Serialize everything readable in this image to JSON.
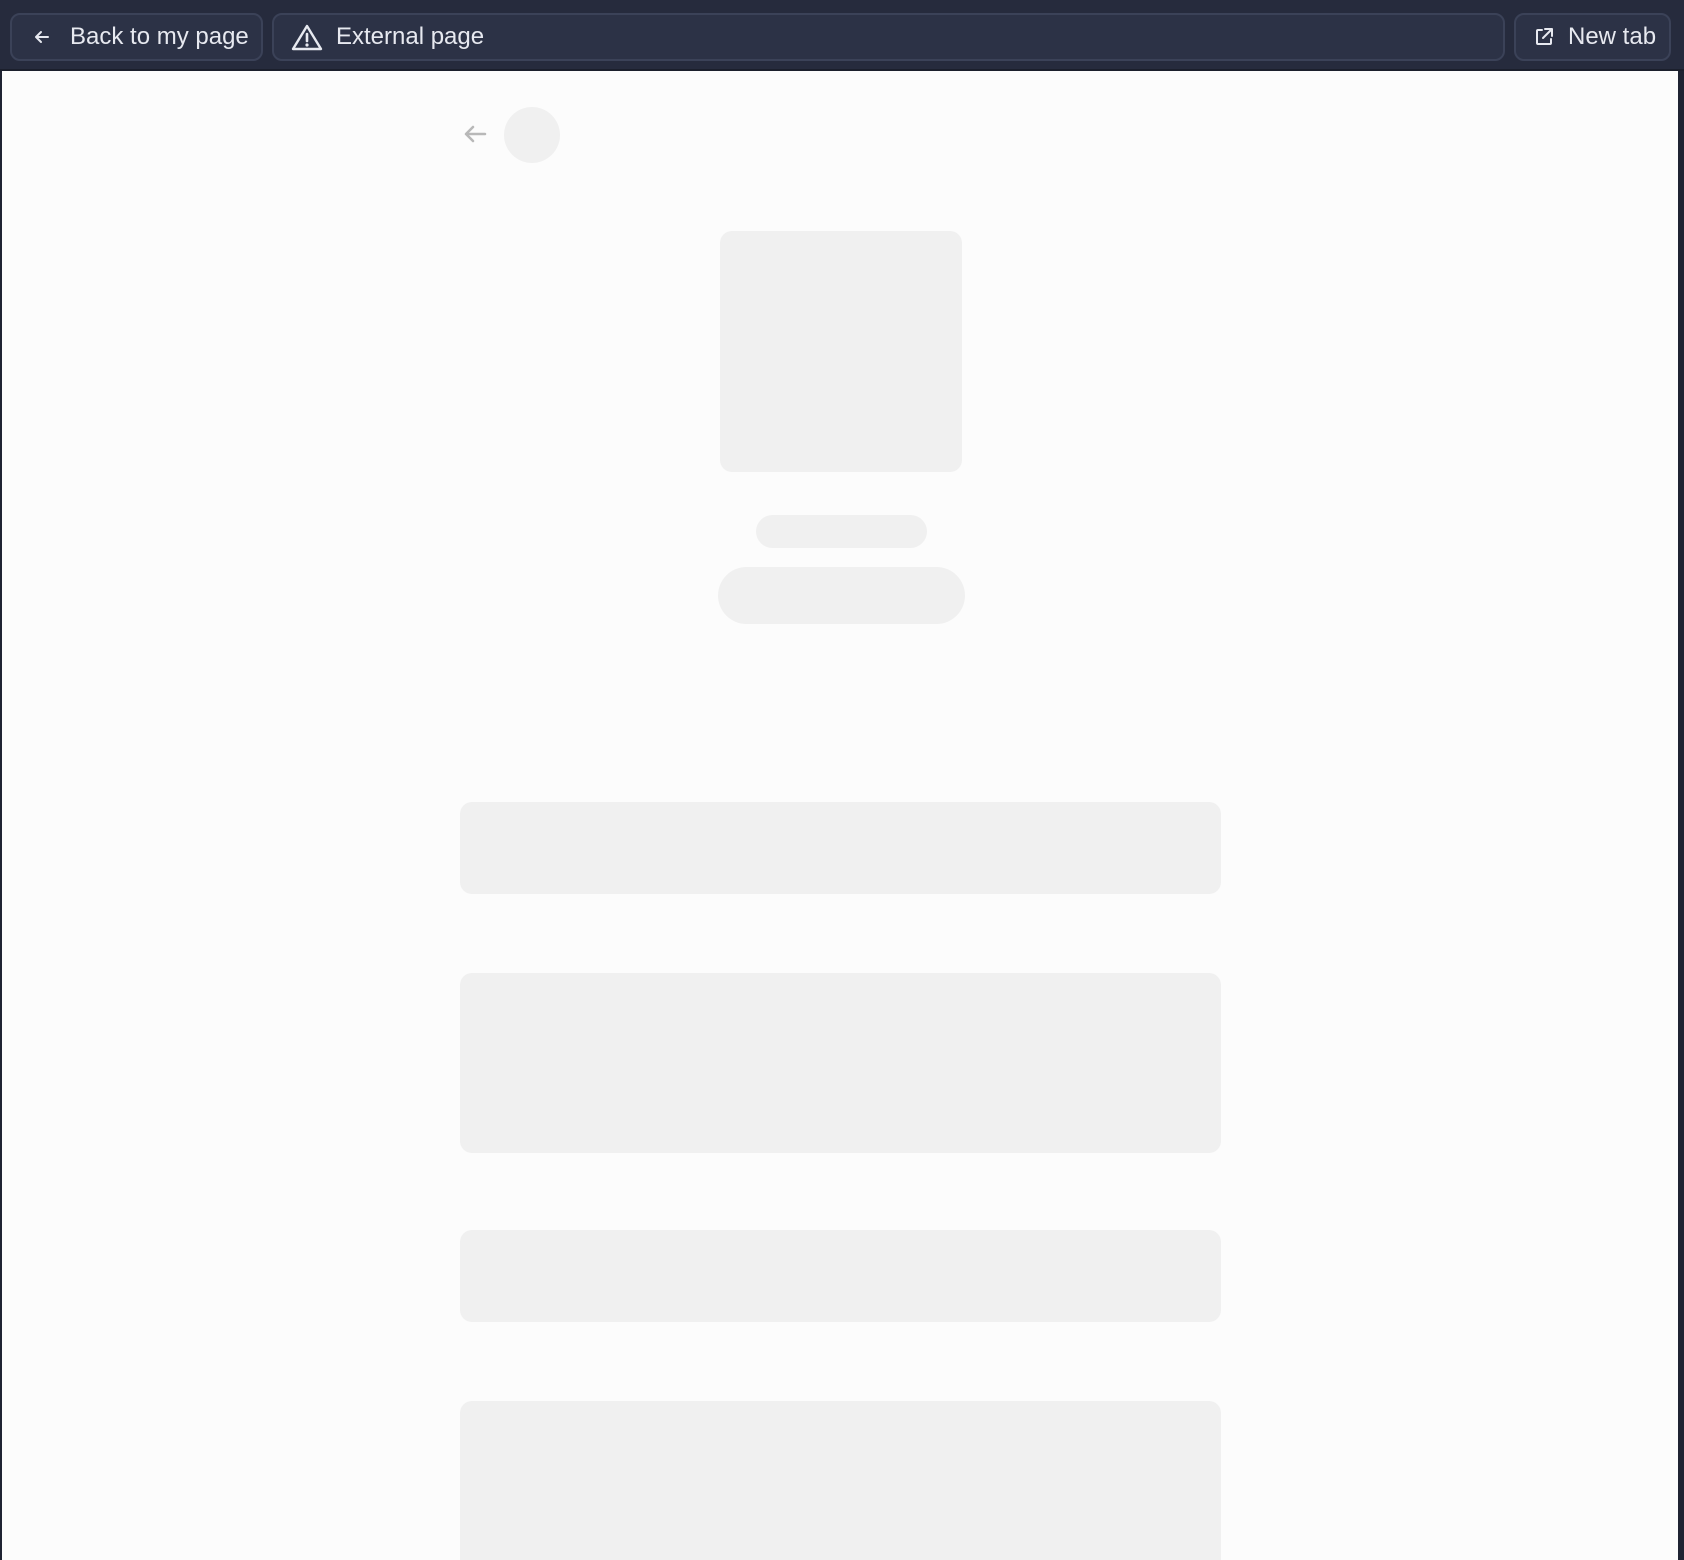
{
  "toolbar": {
    "back_label": "Back to my page",
    "address_label": "External page",
    "new_tab_label": "New tab"
  },
  "icons": {
    "back": "arrow-left-icon",
    "warning": "warning-triangle-icon",
    "external": "external-link-icon",
    "content_back": "arrow-left-icon"
  },
  "colors": {
    "toolbar_background": "#262b3d",
    "button_background": "#2c3246",
    "button_border": "#3b4258",
    "toolbar_text": "#e7e9f0",
    "page_background": "#fcfcfc",
    "skeleton": "#f0f0f0"
  },
  "state": {
    "content_loading": true
  }
}
